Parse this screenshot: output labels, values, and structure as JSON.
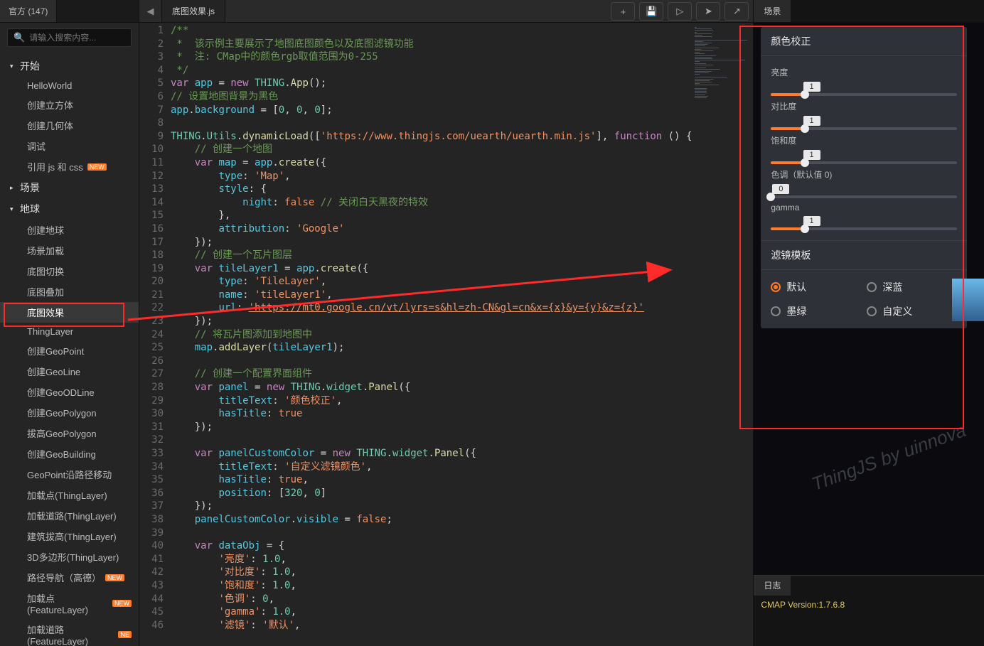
{
  "sidebar": {
    "tab": "官方 (147)",
    "search_placeholder": "请输入搜索内容...",
    "groups": [
      {
        "label": "开始",
        "expanded": true,
        "items": [
          {
            "label": "HelloWorld"
          },
          {
            "label": "创建立方体"
          },
          {
            "label": "创建几何体"
          },
          {
            "label": "调试"
          },
          {
            "label": "引用 js 和 css",
            "badge": "NEW"
          }
        ]
      },
      {
        "label": "场景",
        "expanded": false,
        "items": []
      },
      {
        "label": "地球",
        "expanded": true,
        "items": [
          {
            "label": "创建地球"
          },
          {
            "label": "场景加载"
          },
          {
            "label": "底图切换"
          },
          {
            "label": "底图叠加"
          },
          {
            "label": "底图效果",
            "active": true
          },
          {
            "label": "ThingLayer"
          },
          {
            "label": "创建GeoPoint"
          },
          {
            "label": "创建GeoLine"
          },
          {
            "label": "创建GeoODLine"
          },
          {
            "label": "创建GeoPolygon"
          },
          {
            "label": "拔高GeoPolygon"
          },
          {
            "label": "创建GeoBuilding"
          },
          {
            "label": "GeoPoint沿路径移动"
          },
          {
            "label": "加载点(ThingLayer)"
          },
          {
            "label": "加载道路(ThingLayer)"
          },
          {
            "label": "建筑拔高(ThingLayer)"
          },
          {
            "label": "3D多边形(ThingLayer)"
          },
          {
            "label": "路径导航（高德）",
            "badge": "NEW"
          },
          {
            "label": "加载点(FeatureLayer)",
            "badge": "NEW"
          },
          {
            "label": "加载道路(FeatureLayer)",
            "badge": "NE"
          }
        ]
      }
    ]
  },
  "editor": {
    "tab": "底图效果.js",
    "lines": [
      {
        "n": 1,
        "segs": [
          [
            "cmt",
            "/**"
          ]
        ]
      },
      {
        "n": 2,
        "segs": [
          [
            "cmt",
            " *  该示例主要展示了地图底图颜色以及底图滤镜功能"
          ]
        ]
      },
      {
        "n": 3,
        "segs": [
          [
            "cmt",
            " *  注: CMap中的颜色rgb取值范围为0-255"
          ]
        ]
      },
      {
        "n": 4,
        "segs": [
          [
            "cmt",
            " */"
          ]
        ]
      },
      {
        "n": 5,
        "segs": [
          [
            "kw",
            "var"
          ],
          [
            "dot",
            " "
          ],
          [
            "id",
            "app"
          ],
          [
            "dot",
            " = "
          ],
          [
            "kw",
            "new"
          ],
          [
            "dot",
            " "
          ],
          [
            "type",
            "THING"
          ],
          [
            "dot",
            "."
          ],
          [
            "fn",
            "App"
          ],
          [
            "dot",
            "();"
          ]
        ]
      },
      {
        "n": 6,
        "segs": [
          [
            "cmt",
            "// 设置地图背景为黑色"
          ]
        ]
      },
      {
        "n": 7,
        "segs": [
          [
            "id",
            "app"
          ],
          [
            "dot",
            "."
          ],
          [
            "id",
            "background"
          ],
          [
            "dot",
            " = ["
          ],
          [
            "num",
            "0"
          ],
          [
            "dot",
            ", "
          ],
          [
            "num",
            "0"
          ],
          [
            "dot",
            ", "
          ],
          [
            "num",
            "0"
          ],
          [
            "dot",
            "];"
          ]
        ]
      },
      {
        "n": 8,
        "segs": [
          [
            "dot",
            ""
          ]
        ]
      },
      {
        "n": 9,
        "segs": [
          [
            "type",
            "THING"
          ],
          [
            "dot",
            "."
          ],
          [
            "type",
            "Utils"
          ],
          [
            "dot",
            "."
          ],
          [
            "fn",
            "dynamicLoad"
          ],
          [
            "dot",
            "(["
          ],
          [
            "str",
            "'https://www.thingjs.com/uearth/uearth.min.js'"
          ],
          [
            "dot",
            "], "
          ],
          [
            "kw",
            "function"
          ],
          [
            "dot",
            " "
          ],
          [
            "dot",
            "() {"
          ]
        ]
      },
      {
        "n": 10,
        "segs": [
          [
            "dot",
            "    "
          ],
          [
            "cmt",
            "// 创建一个地图"
          ]
        ]
      },
      {
        "n": 11,
        "segs": [
          [
            "dot",
            "    "
          ],
          [
            "kw",
            "var"
          ],
          [
            "dot",
            " "
          ],
          [
            "id",
            "map"
          ],
          [
            "dot",
            " = "
          ],
          [
            "id",
            "app"
          ],
          [
            "dot",
            "."
          ],
          [
            "fn",
            "create"
          ],
          [
            "dot",
            "({"
          ]
        ]
      },
      {
        "n": 12,
        "segs": [
          [
            "dot",
            "        "
          ],
          [
            "id",
            "type"
          ],
          [
            "dot",
            ": "
          ],
          [
            "str",
            "'Map'"
          ],
          [
            "dot",
            ","
          ]
        ]
      },
      {
        "n": 13,
        "segs": [
          [
            "dot",
            "        "
          ],
          [
            "id",
            "style"
          ],
          [
            "dot",
            ": {"
          ]
        ]
      },
      {
        "n": 14,
        "segs": [
          [
            "dot",
            "            "
          ],
          [
            "id",
            "night"
          ],
          [
            "dot",
            ": "
          ],
          [
            "bool",
            "false"
          ],
          [
            "dot",
            " "
          ],
          [
            "cmt",
            "// 关闭白天黑夜的特效"
          ]
        ]
      },
      {
        "n": 15,
        "segs": [
          [
            "dot",
            "        },"
          ]
        ]
      },
      {
        "n": 16,
        "segs": [
          [
            "dot",
            "        "
          ],
          [
            "id",
            "attribution"
          ],
          [
            "dot",
            ": "
          ],
          [
            "str",
            "'Google'"
          ]
        ]
      },
      {
        "n": 17,
        "segs": [
          [
            "dot",
            "    });"
          ]
        ]
      },
      {
        "n": 18,
        "segs": [
          [
            "dot",
            "    "
          ],
          [
            "cmt",
            "// 创建一个瓦片图层"
          ]
        ]
      },
      {
        "n": 19,
        "segs": [
          [
            "dot",
            "    "
          ],
          [
            "kw",
            "var"
          ],
          [
            "dot",
            " "
          ],
          [
            "id",
            "tileLayer1"
          ],
          [
            "dot",
            " = "
          ],
          [
            "id",
            "app"
          ],
          [
            "dot",
            "."
          ],
          [
            "fn",
            "create"
          ],
          [
            "dot",
            "({"
          ]
        ]
      },
      {
        "n": 20,
        "segs": [
          [
            "dot",
            "        "
          ],
          [
            "id",
            "type"
          ],
          [
            "dot",
            ": "
          ],
          [
            "str",
            "'TileLayer'"
          ],
          [
            "dot",
            ","
          ]
        ]
      },
      {
        "n": 21,
        "segs": [
          [
            "dot",
            "        "
          ],
          [
            "id",
            "name"
          ],
          [
            "dot",
            ": "
          ],
          [
            "str",
            "'tileLayer1'"
          ],
          [
            "dot",
            ","
          ]
        ]
      },
      {
        "n": 22,
        "segs": [
          [
            "dot",
            "        "
          ],
          [
            "id",
            "url"
          ],
          [
            "dot",
            ": "
          ],
          [
            "url",
            "'https://mt0.google.cn/vt/lyrs=s&hl=zh-CN&gl=cn&x={x}&y={y}&z={z}'"
          ]
        ]
      },
      {
        "n": 23,
        "segs": [
          [
            "dot",
            "    });"
          ]
        ]
      },
      {
        "n": 24,
        "segs": [
          [
            "dot",
            "    "
          ],
          [
            "cmt",
            "// 将瓦片图添加到地图中"
          ]
        ]
      },
      {
        "n": 25,
        "segs": [
          [
            "dot",
            "    "
          ],
          [
            "id",
            "map"
          ],
          [
            "dot",
            "."
          ],
          [
            "fn",
            "addLayer"
          ],
          [
            "dot",
            "("
          ],
          [
            "id",
            "tileLayer1"
          ],
          [
            "dot",
            ");"
          ]
        ]
      },
      {
        "n": 26,
        "segs": [
          [
            "dot",
            ""
          ]
        ]
      },
      {
        "n": 27,
        "segs": [
          [
            "dot",
            "    "
          ],
          [
            "cmt",
            "// 创建一个配置界面组件"
          ]
        ]
      },
      {
        "n": 28,
        "segs": [
          [
            "dot",
            "    "
          ],
          [
            "kw",
            "var"
          ],
          [
            "dot",
            " "
          ],
          [
            "id",
            "panel"
          ],
          [
            "dot",
            " = "
          ],
          [
            "kw",
            "new"
          ],
          [
            "dot",
            " "
          ],
          [
            "type",
            "THING"
          ],
          [
            "dot",
            "."
          ],
          [
            "type",
            "widget"
          ],
          [
            "dot",
            "."
          ],
          [
            "fn",
            "Panel"
          ],
          [
            "dot",
            "({"
          ]
        ]
      },
      {
        "n": 29,
        "segs": [
          [
            "dot",
            "        "
          ],
          [
            "id",
            "titleText"
          ],
          [
            "dot",
            ": "
          ],
          [
            "str",
            "'颜色校正'"
          ],
          [
            "dot",
            ","
          ]
        ]
      },
      {
        "n": 30,
        "segs": [
          [
            "dot",
            "        "
          ],
          [
            "id",
            "hasTitle"
          ],
          [
            "dot",
            ": "
          ],
          [
            "bool",
            "true"
          ]
        ]
      },
      {
        "n": 31,
        "segs": [
          [
            "dot",
            "    });"
          ]
        ]
      },
      {
        "n": 32,
        "segs": [
          [
            "dot",
            ""
          ]
        ]
      },
      {
        "n": 33,
        "segs": [
          [
            "dot",
            "    "
          ],
          [
            "kw",
            "var"
          ],
          [
            "dot",
            " "
          ],
          [
            "id",
            "panelCustomColor"
          ],
          [
            "dot",
            " = "
          ],
          [
            "kw",
            "new"
          ],
          [
            "dot",
            " "
          ],
          [
            "type",
            "THING"
          ],
          [
            "dot",
            "."
          ],
          [
            "type",
            "widget"
          ],
          [
            "dot",
            "."
          ],
          [
            "fn",
            "Panel"
          ],
          [
            "dot",
            "({"
          ]
        ]
      },
      {
        "n": 34,
        "segs": [
          [
            "dot",
            "        "
          ],
          [
            "id",
            "titleText"
          ],
          [
            "dot",
            ": "
          ],
          [
            "str",
            "'自定义滤镜颜色'"
          ],
          [
            "dot",
            ","
          ]
        ]
      },
      {
        "n": 35,
        "segs": [
          [
            "dot",
            "        "
          ],
          [
            "id",
            "hasTitle"
          ],
          [
            "dot",
            ": "
          ],
          [
            "bool",
            "true"
          ],
          [
            "dot",
            ","
          ]
        ]
      },
      {
        "n": 36,
        "segs": [
          [
            "dot",
            "        "
          ],
          [
            "id",
            "position"
          ],
          [
            "dot",
            ": ["
          ],
          [
            "num",
            "320"
          ],
          [
            "dot",
            ", "
          ],
          [
            "num",
            "0"
          ],
          [
            "dot",
            "]"
          ]
        ]
      },
      {
        "n": 37,
        "segs": [
          [
            "dot",
            "    });"
          ]
        ]
      },
      {
        "n": 38,
        "segs": [
          [
            "dot",
            "    "
          ],
          [
            "id",
            "panelCustomColor"
          ],
          [
            "dot",
            "."
          ],
          [
            "id",
            "visible"
          ],
          [
            "dot",
            " = "
          ],
          [
            "bool",
            "false"
          ],
          [
            "dot",
            ";"
          ]
        ]
      },
      {
        "n": 39,
        "segs": [
          [
            "dot",
            ""
          ]
        ]
      },
      {
        "n": 40,
        "segs": [
          [
            "dot",
            "    "
          ],
          [
            "kw",
            "var"
          ],
          [
            "dot",
            " "
          ],
          [
            "id",
            "dataObj"
          ],
          [
            "dot",
            " = {"
          ]
        ]
      },
      {
        "n": 41,
        "segs": [
          [
            "dot",
            "        "
          ],
          [
            "str",
            "'亮度'"
          ],
          [
            "dot",
            ": "
          ],
          [
            "num",
            "1.0"
          ],
          [
            "dot",
            ","
          ]
        ]
      },
      {
        "n": 42,
        "segs": [
          [
            "dot",
            "        "
          ],
          [
            "str",
            "'对比度'"
          ],
          [
            "dot",
            ": "
          ],
          [
            "num",
            "1.0"
          ],
          [
            "dot",
            ","
          ]
        ]
      },
      {
        "n": 43,
        "segs": [
          [
            "dot",
            "        "
          ],
          [
            "str",
            "'饱和度'"
          ],
          [
            "dot",
            ": "
          ],
          [
            "num",
            "1.0"
          ],
          [
            "dot",
            ","
          ]
        ]
      },
      {
        "n": 44,
        "segs": [
          [
            "dot",
            "        "
          ],
          [
            "str",
            "'色调'"
          ],
          [
            "dot",
            ": "
          ],
          [
            "num",
            "0"
          ],
          [
            "dot",
            ","
          ]
        ]
      },
      {
        "n": 45,
        "segs": [
          [
            "dot",
            "        "
          ],
          [
            "str",
            "'gamma'"
          ],
          [
            "dot",
            ": "
          ],
          [
            "num",
            "1.0"
          ],
          [
            "dot",
            ","
          ]
        ]
      },
      {
        "n": 46,
        "segs": [
          [
            "dot",
            "        "
          ],
          [
            "str",
            "'滤镜'"
          ],
          [
            "dot",
            ": "
          ],
          [
            "str",
            "'默认'"
          ],
          [
            "dot",
            ","
          ]
        ]
      }
    ]
  },
  "right": {
    "scene_tab": "场景",
    "panel1": {
      "title": "颜色校正",
      "sliders": [
        {
          "label": "亮度",
          "value": "1",
          "fill": 18
        },
        {
          "label": "对比度",
          "value": "1",
          "fill": 18
        },
        {
          "label": "饱和度",
          "value": "1",
          "fill": 18
        },
        {
          "label": "色调（默认值 0)",
          "value": "0",
          "fill": 0
        },
        {
          "label": "gamma",
          "value": "1",
          "fill": 18
        }
      ]
    },
    "panel2": {
      "title": "滤镜模板",
      "options": [
        "默认",
        "深蓝",
        "墨绿",
        "自定义"
      ],
      "selected": 0
    },
    "watermark": "ThingJS by uinnova",
    "log_tab": "日志",
    "log_line": "CMAP Version:1.7.6.8"
  }
}
